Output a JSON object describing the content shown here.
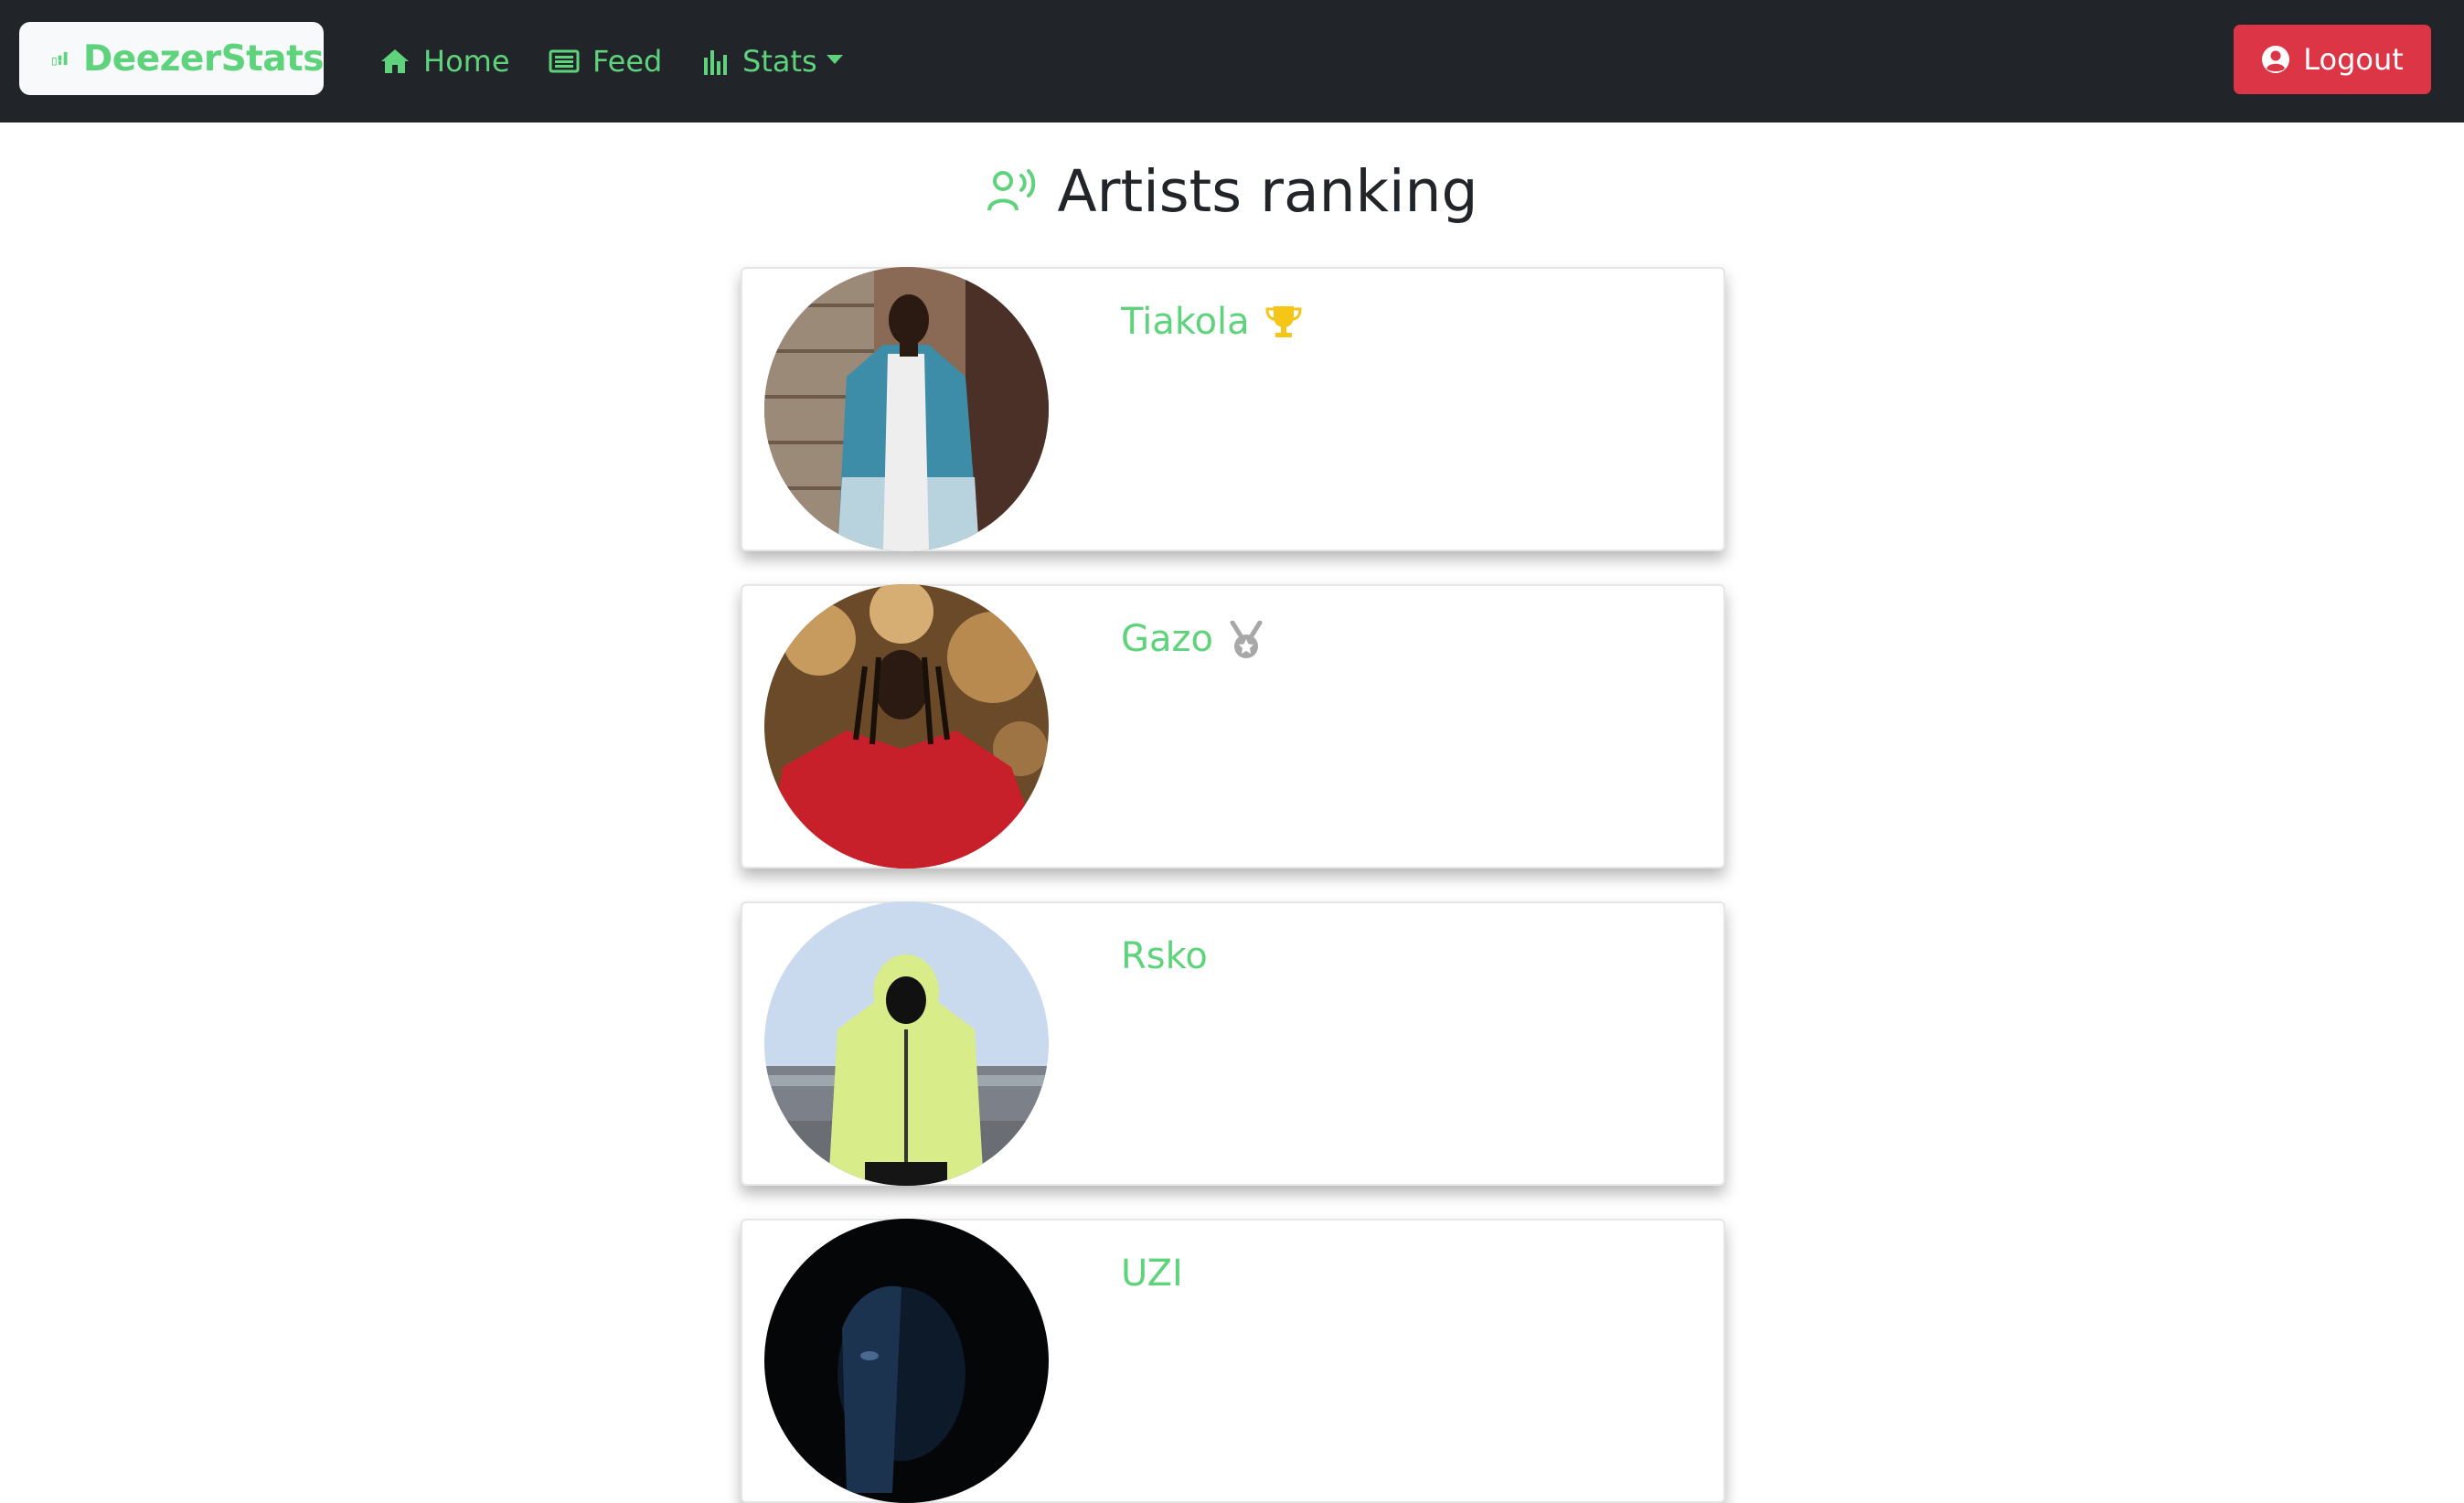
{
  "navbar": {
    "brand": "DeezerStats",
    "items": [
      {
        "label": "Home",
        "icon": "home-icon"
      },
      {
        "label": "Feed",
        "icon": "newspaper-icon"
      },
      {
        "label": "Stats",
        "icon": "bar-chart-icon"
      }
    ],
    "logout_label": "Logout"
  },
  "page": {
    "title": "Artists ranking",
    "title_icon": "person-voice-icon"
  },
  "artists": [
    {
      "name": "Tiakola",
      "badge": "trophy-icon"
    },
    {
      "name": "Gazo",
      "badge": "medal-icon"
    },
    {
      "name": "Rsko",
      "badge": ""
    },
    {
      "name": "UZI",
      "badge": ""
    }
  ],
  "colors": {
    "navbar_bg": "#212529",
    "accent_green": "#5fd37c",
    "logout_red": "#dc3545",
    "trophy_gold": "#f5c518",
    "medal_silver": "#a8a8a8"
  }
}
